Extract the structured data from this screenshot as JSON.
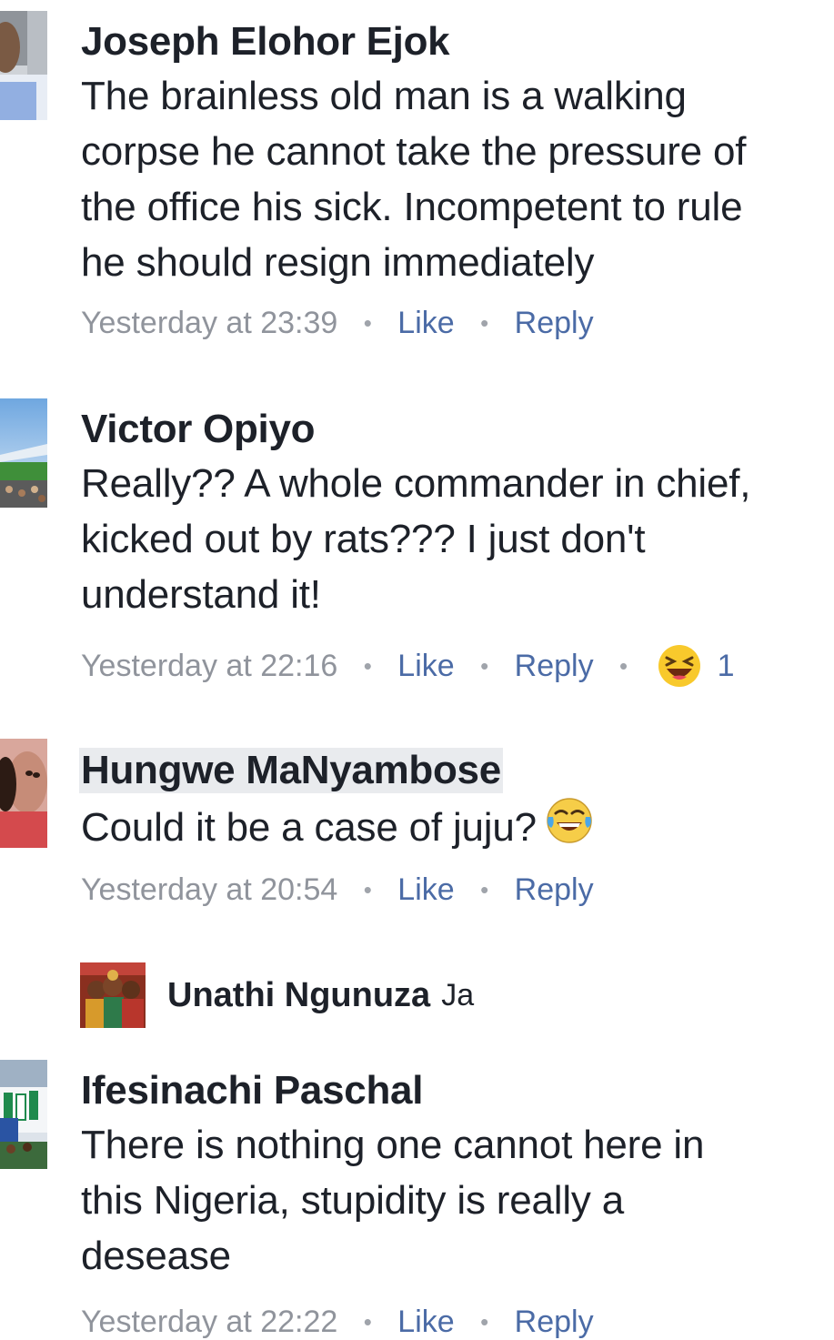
{
  "comments": [
    {
      "author": "Joseph Elohor Ejok",
      "lines": [
        "The brainless old man is a walking",
        "corpse he cannot take the pressure of",
        "the office his sick. Incompetent to rule",
        "he should resign immediately"
      ],
      "time": "Yesterday at 23:39",
      "like": "Like",
      "reply": "Reply"
    },
    {
      "author": "Victor Opiyo",
      "lines": [
        "Really?? A whole commander in chief,",
        "kicked out by rats??? I just don't",
        "understand it!"
      ],
      "time": "Yesterday at 22:16",
      "like": "Like",
      "reply": "Reply",
      "reaction": {
        "icon": "laughing-squint-emoji",
        "count": "1"
      }
    },
    {
      "author": "Hungwe MaNyambose",
      "lines": [
        "Could it be a case of juju?"
      ],
      "inline_emoji": "tears-of-joy-emoji",
      "time": "Yesterday at 20:54",
      "like": "Like",
      "reply": "Reply"
    },
    {
      "author": "Ifesinachi Paschal",
      "lines": [
        "There is nothing one cannot here in",
        "this Nigeria,  stupidity is really a",
        "desease"
      ],
      "time": "Yesterday at 22:22",
      "like": "Like",
      "reply": "Reply"
    }
  ],
  "typing_row": {
    "name": "Unathi Ngunuza",
    "suffix": "Ja"
  },
  "colors": {
    "link": "#4b6ba6",
    "meta": "#90949c",
    "text": "#1d2129",
    "highlight": "#e9ebee"
  }
}
